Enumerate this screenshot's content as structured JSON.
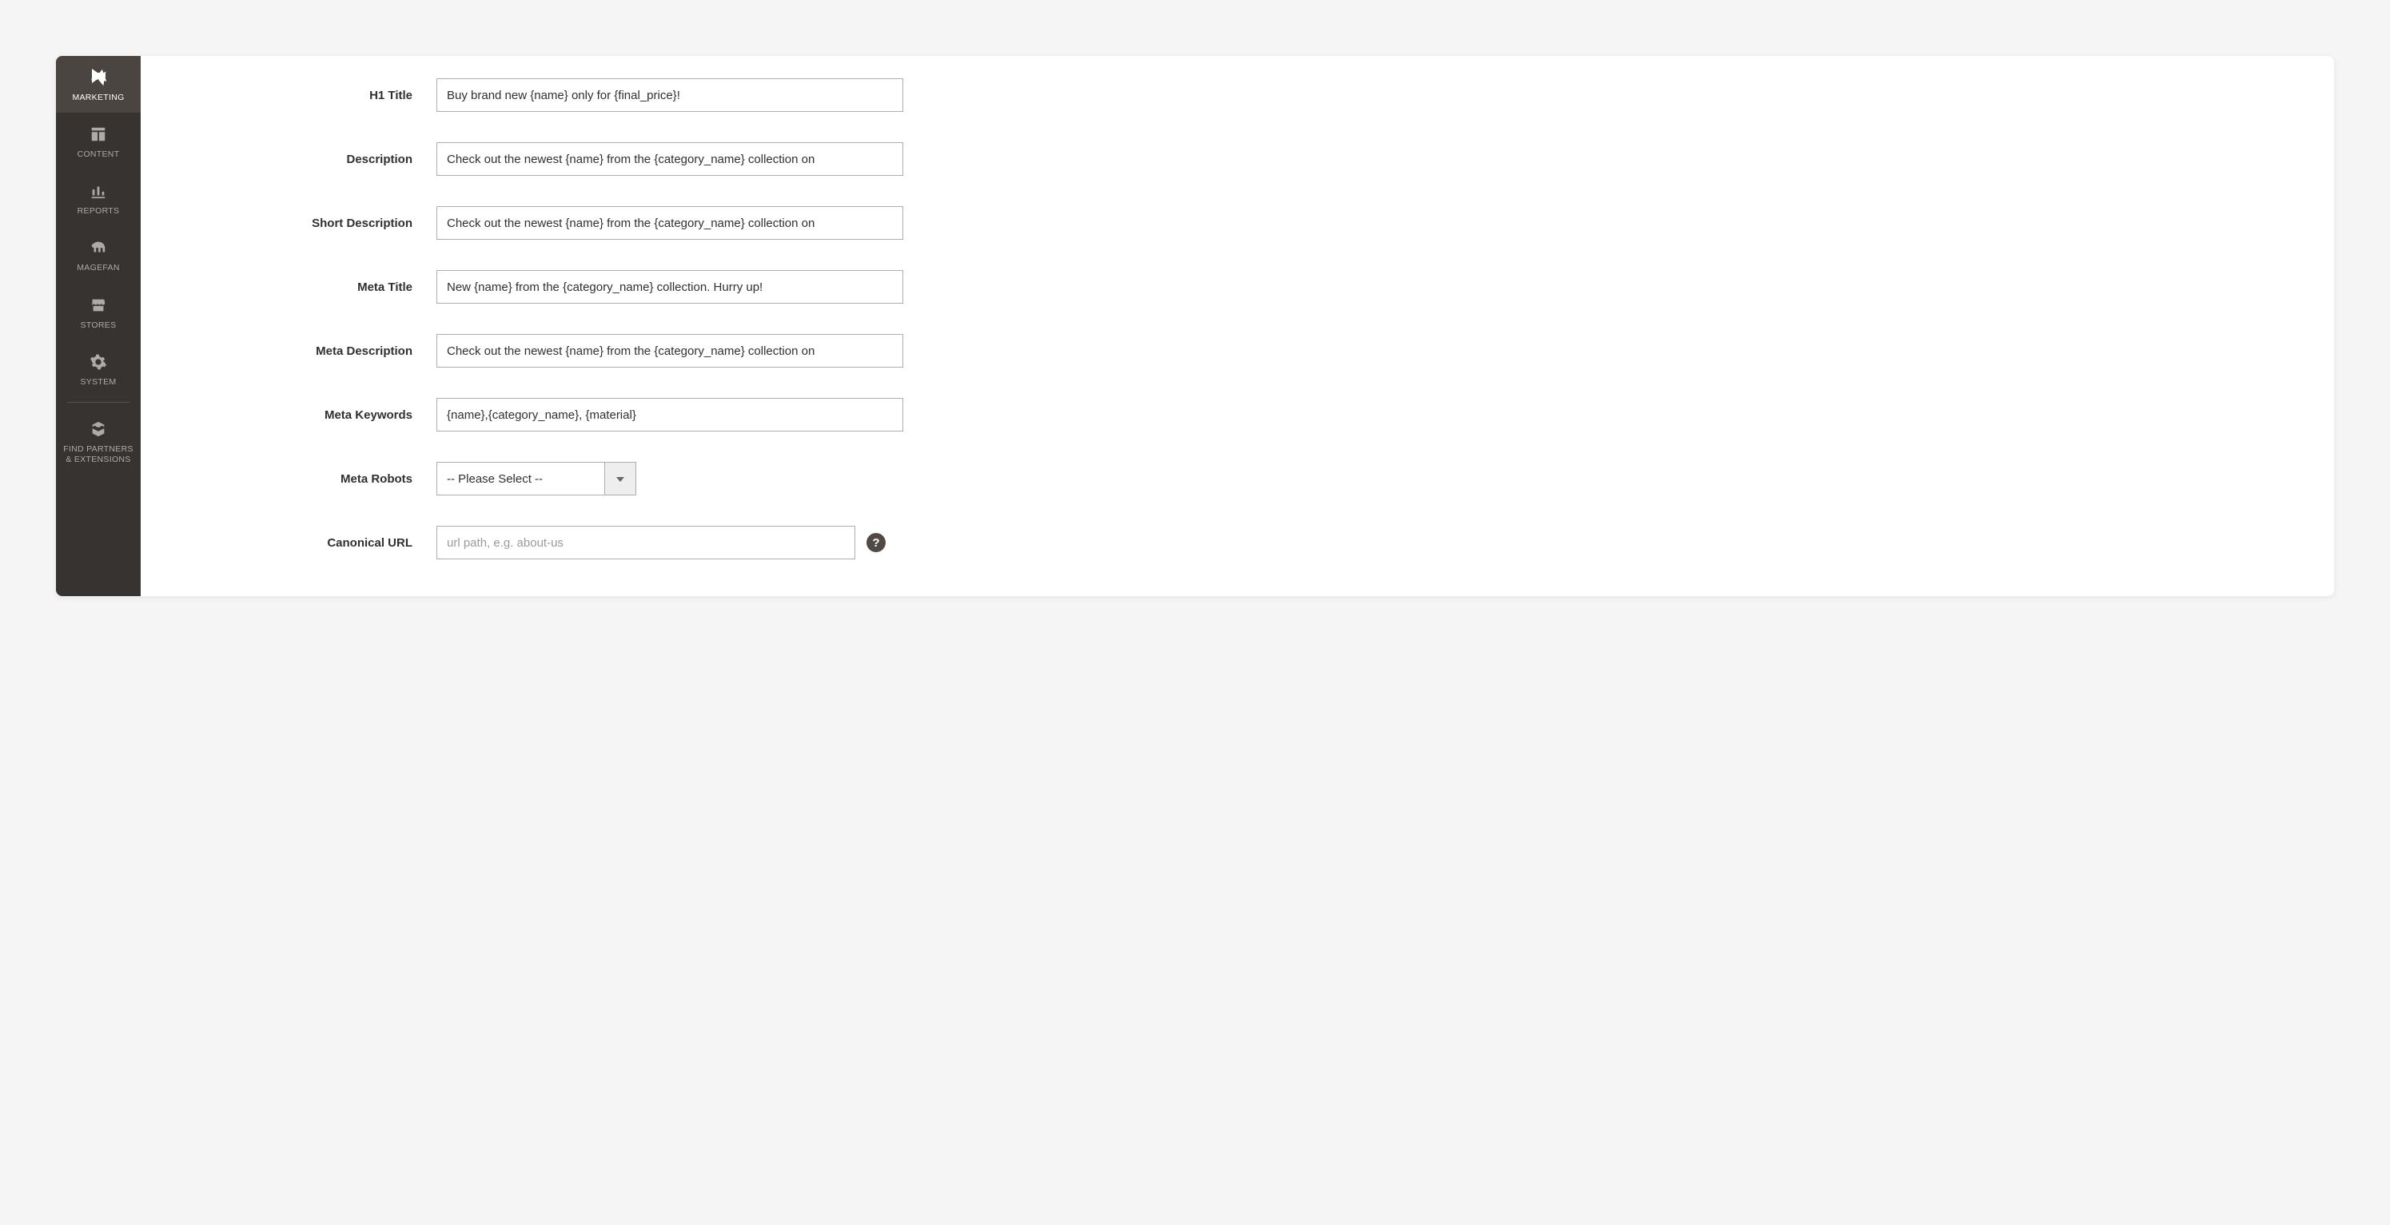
{
  "sidebar": {
    "items": [
      {
        "label": "MARKETING"
      },
      {
        "label": "CONTENT"
      },
      {
        "label": "REPORTS"
      },
      {
        "label": "MAGEFAN"
      },
      {
        "label": "STORES"
      },
      {
        "label": "SYSTEM"
      },
      {
        "label": "FIND PARTNERS\n& EXTENSIONS"
      }
    ]
  },
  "form": {
    "h1_title": {
      "label": "H1 Title",
      "value": "Buy brand new {name} only for {final_price}!"
    },
    "description": {
      "label": "Description",
      "value": "Check out the newest {name} from the {category_name} collection on"
    },
    "short_description": {
      "label": "Short Description",
      "value": "Check out the newest {name} from the {category_name} collection on"
    },
    "meta_title": {
      "label": "Meta Title",
      "value": "New {name} from the {category_name} collection. Hurry up!"
    },
    "meta_description": {
      "label": "Meta Description",
      "value": "Check out the newest {name} from the {category_name} collection on"
    },
    "meta_keywords": {
      "label": "Meta Keywords",
      "value": "{name},{category_name}, {material}"
    },
    "meta_robots": {
      "label": "Meta Robots",
      "value": "-- Please Select --"
    },
    "canonical_url": {
      "label": "Canonical URL",
      "placeholder": "url path, e.g. about-us"
    }
  },
  "help_glyph": "?"
}
